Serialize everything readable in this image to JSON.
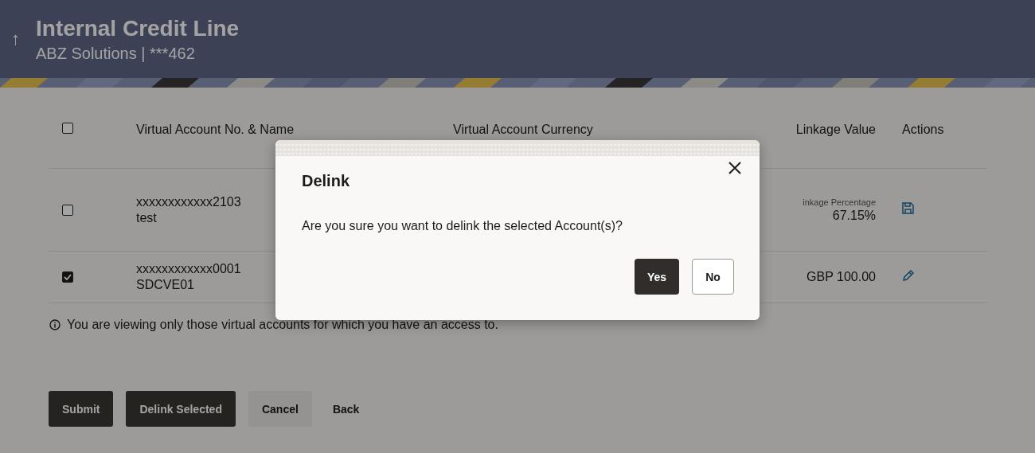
{
  "header": {
    "back_icon": "↑",
    "title": "Internal Credit Line",
    "subtitle": "ABZ Solutions | ***462"
  },
  "table": {
    "select_all": {
      "checked": false
    },
    "columns": [
      "Virtual Account No. & Name",
      "Virtual Account Currency",
      "Linkage Value",
      "Actions"
    ],
    "rows": [
      {
        "checked": false,
        "account": "xxxxxxxxxxxx2103",
        "name": "test",
        "linkage_label": "inkage Percentage",
        "linkage_value": "67.15%",
        "kind": "save"
      },
      {
        "checked": true,
        "account": "xxxxxxxxxxxx0001",
        "name": "SDCVE01",
        "linkage_value": "GBP 100.00",
        "kind": "edit"
      }
    ]
  },
  "note": "You are viewing only those virtual accounts for which you have an access to.",
  "buttons": [
    {
      "label": "Submit",
      "kind": "primary"
    },
    {
      "label": "Delink Selected",
      "kind": "primary"
    },
    {
      "label": "Cancel",
      "kind": "secondary"
    },
    {
      "label": "Back",
      "kind": "link"
    }
  ],
  "dialog": {
    "title": "Delink",
    "message": "Are you sure you want to delink the selected Account(s)?",
    "buttons": [
      {
        "label": "Yes",
        "kind": "primary"
      },
      {
        "label": "No",
        "kind": "outline"
      }
    ]
  }
}
